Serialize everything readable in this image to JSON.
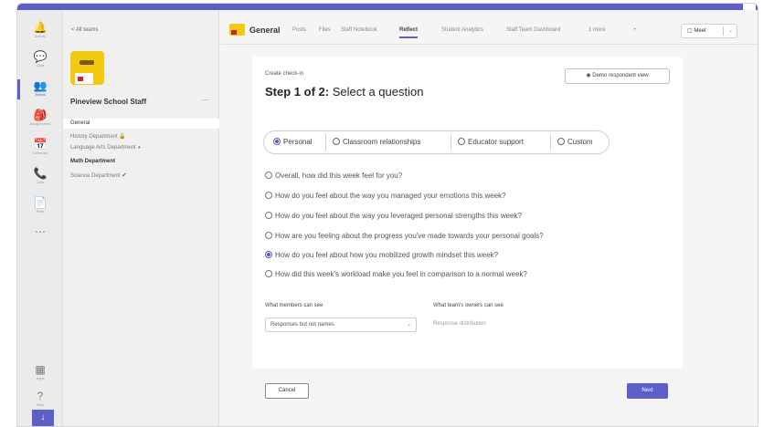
{
  "rail": {
    "items": [
      {
        "icon": "bell-icon",
        "glyph": "🔔",
        "label": "Activity"
      },
      {
        "icon": "chat-icon",
        "glyph": "💬",
        "label": "Chat"
      },
      {
        "icon": "teams-icon",
        "glyph": "👥",
        "label": "Teams"
      },
      {
        "icon": "assignments-icon",
        "glyph": "🎒",
        "label": "Assignments"
      },
      {
        "icon": "calendar-icon",
        "glyph": "📅",
        "label": "Calendar"
      },
      {
        "icon": "calls-icon",
        "glyph": "📞",
        "label": "Calls"
      },
      {
        "icon": "files-icon",
        "glyph": "📄",
        "label": "Files"
      },
      {
        "icon": "more-icon",
        "glyph": "⋯",
        "label": ""
      },
      {
        "icon": "apps-icon",
        "glyph": "▦",
        "label": "Apps"
      },
      {
        "icon": "help-icon",
        "glyph": "?",
        "label": "Help"
      }
    ],
    "download_glyph": "↓"
  },
  "teams_pane": {
    "back_label": "< All teams",
    "team_name": "Pineview School Staff",
    "more_glyph": "⋯",
    "channels": [
      {
        "label": "General"
      },
      {
        "label": "History Department"
      },
      {
        "label": "Language Arts Department"
      },
      {
        "label": "Math Department"
      },
      {
        "label": "Science Department"
      }
    ]
  },
  "header": {
    "channel_title": "General",
    "tabs": [
      "Posts",
      "Files",
      "Staff Notebook",
      "Reflect",
      "Student Analytics",
      "Staff Team Dashboard",
      "1 more"
    ],
    "add_tab_glyph": "+",
    "meet_label": "Meet"
  },
  "panel": {
    "subtitle": "Create check-in",
    "step_prefix": "Step 1 of 2:",
    "step_title": "Select a question",
    "demo_button": "Demo respondent view",
    "categories": [
      "Personal",
      "Classroom relationships",
      "Educator support",
      "Custom"
    ],
    "questions": [
      "Overall, how did this week feel for you?",
      "How do you feel about the way you managed your emotions this week?",
      "How do you feel about the way you leveraged personal strengths this week?",
      "How are you feeling about the progress you've made towards your personal goals?",
      "How do you feel about how you mobilized growth mindset this week?",
      "How did this week's workload make you feel in comparison to a normal week?"
    ],
    "selected_question_index": 4,
    "members_label": "What members can see",
    "members_value": "Responses but not names",
    "owners_label": "What team's owners can see",
    "owners_value": "Response distribution"
  },
  "footer": {
    "cancel_label": "Cancel",
    "next_label": "Next"
  },
  "colors": {
    "accent": "#5b5fc7",
    "team_avatar": "#f2c811"
  }
}
